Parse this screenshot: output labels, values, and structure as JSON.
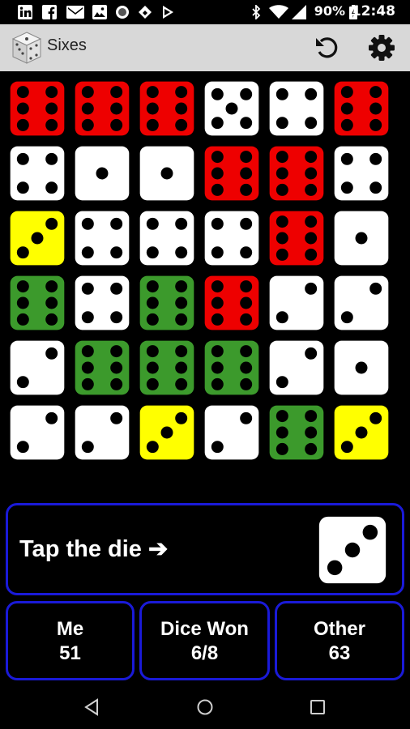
{
  "status_bar": {
    "battery": "90%",
    "time": "12:48",
    "left_icons": [
      "linkedin-icon",
      "facebook-icon",
      "gmail-icon",
      "image-icon",
      "circle-icon",
      "feedly-icon",
      "play-store-icon"
    ],
    "right_icons": [
      "bluetooth-icon",
      "wifi-icon",
      "signal-icon",
      "battery-icon"
    ]
  },
  "app_bar": {
    "title": "Sixes",
    "actions": [
      "undo-icon",
      "settings-icon"
    ]
  },
  "colors": {
    "red": "#ee0000",
    "white": "#ffffff",
    "yellow": "#ffff00",
    "green": "#3c9a2c",
    "panel_border": "#1a1ad8",
    "pip": "#000000"
  },
  "board": {
    "rows": [
      [
        {
          "value": 6,
          "color": "red"
        },
        {
          "value": 6,
          "color": "red"
        },
        {
          "value": 6,
          "color": "red"
        },
        {
          "value": 5,
          "color": "white"
        },
        {
          "value": 4,
          "color": "white"
        },
        {
          "value": 6,
          "color": "red"
        }
      ],
      [
        {
          "value": 4,
          "color": "white"
        },
        {
          "value": 1,
          "color": "white"
        },
        {
          "value": 1,
          "color": "white"
        },
        {
          "value": 6,
          "color": "red"
        },
        {
          "value": 6,
          "color": "red"
        },
        {
          "value": 4,
          "color": "white"
        }
      ],
      [
        {
          "value": 3,
          "color": "yellow"
        },
        {
          "value": 4,
          "color": "white"
        },
        {
          "value": 4,
          "color": "white"
        },
        {
          "value": 4,
          "color": "white"
        },
        {
          "value": 6,
          "color": "red"
        },
        {
          "value": 1,
          "color": "white"
        }
      ],
      [
        {
          "value": 6,
          "color": "green"
        },
        {
          "value": 4,
          "color": "white"
        },
        {
          "value": 6,
          "color": "green"
        },
        {
          "value": 6,
          "color": "red"
        },
        {
          "value": 2,
          "color": "white"
        },
        {
          "value": 2,
          "color": "white"
        }
      ],
      [
        {
          "value": 2,
          "color": "white"
        },
        {
          "value": 6,
          "color": "green"
        },
        {
          "value": 6,
          "color": "green"
        },
        {
          "value": 6,
          "color": "green"
        },
        {
          "value": 2,
          "color": "white"
        },
        {
          "value": 1,
          "color": "white"
        }
      ],
      [
        {
          "value": 2,
          "color": "white"
        },
        {
          "value": 2,
          "color": "white"
        },
        {
          "value": 3,
          "color": "yellow"
        },
        {
          "value": 2,
          "color": "white"
        },
        {
          "value": 6,
          "color": "green"
        },
        {
          "value": 3,
          "color": "yellow"
        }
      ]
    ]
  },
  "tap_panel": {
    "label": "Tap the die",
    "arrow": "➔",
    "die": {
      "value": 3,
      "color": "white"
    }
  },
  "scores": [
    {
      "title": "Me",
      "value": "51"
    },
    {
      "title": "Dice Won",
      "value": "6/8"
    },
    {
      "title": "Other",
      "value": "63"
    }
  ],
  "nav_bar": [
    "back-icon",
    "home-icon",
    "recents-icon"
  ]
}
